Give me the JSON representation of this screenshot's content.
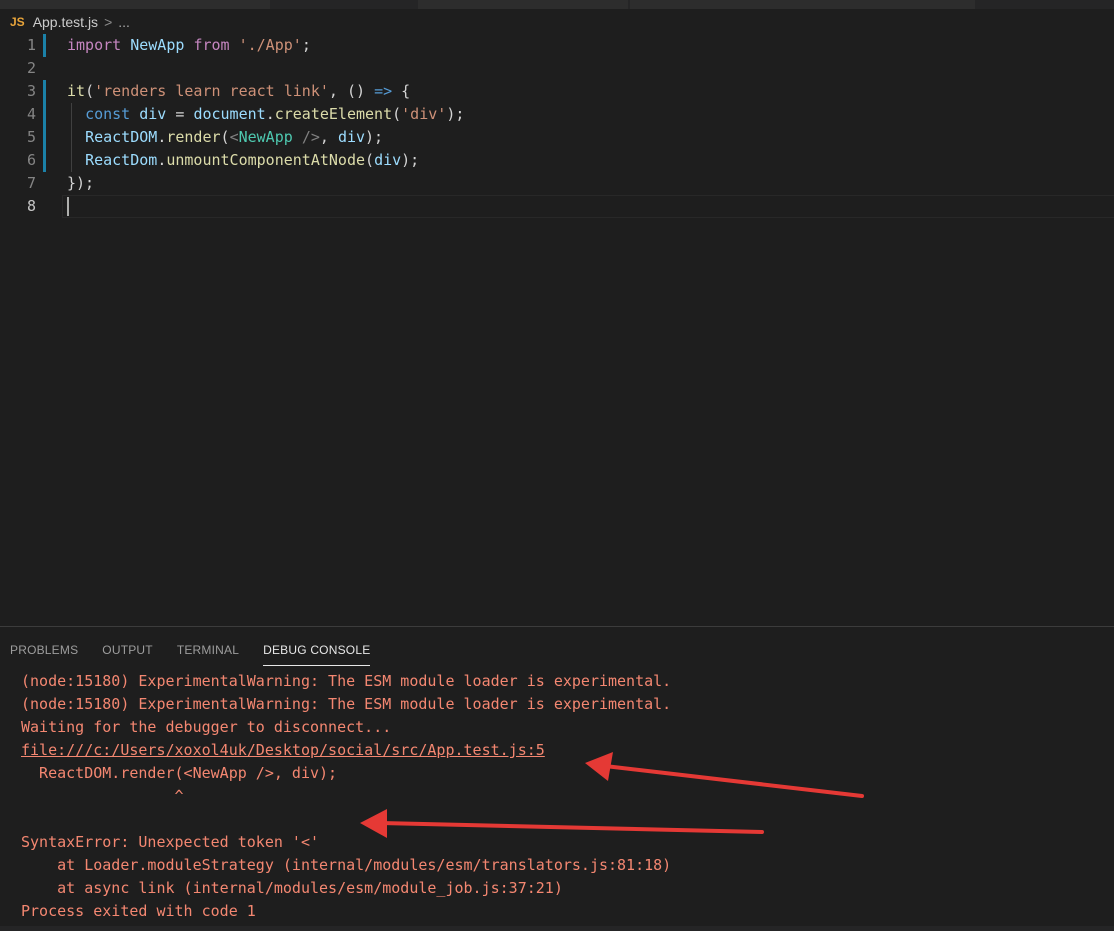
{
  "breadcrumb": {
    "file_type": "JS",
    "file": "App.test.js",
    "separator": ">",
    "more": "..."
  },
  "editor": {
    "line_numbers": [
      "1",
      "2",
      "3",
      "4",
      "5",
      "6",
      "7",
      "8"
    ],
    "lines": [
      [
        {
          "c": "k",
          "t": "import"
        },
        {
          "c": "",
          "t": " "
        },
        {
          "c": "v",
          "t": "NewApp"
        },
        {
          "c": "",
          "t": " "
        },
        {
          "c": "k",
          "t": "from"
        },
        {
          "c": "",
          "t": " "
        },
        {
          "c": "s",
          "t": "'./App'"
        },
        {
          "c": "",
          "t": ";"
        }
      ],
      [],
      [
        {
          "c": "f",
          "t": "it"
        },
        {
          "c": "",
          "t": "("
        },
        {
          "c": "s",
          "t": "'renders learn react link'"
        },
        {
          "c": "",
          "t": ", () "
        },
        {
          "c": "kb",
          "t": "=>"
        },
        {
          "c": "",
          "t": " {"
        }
      ],
      [
        {
          "c": "",
          "t": "  "
        },
        {
          "c": "kb",
          "t": "const"
        },
        {
          "c": "",
          "t": " "
        },
        {
          "c": "v",
          "t": "div"
        },
        {
          "c": "",
          "t": " = "
        },
        {
          "c": "v",
          "t": "document"
        },
        {
          "c": "",
          "t": "."
        },
        {
          "c": "f",
          "t": "createElement"
        },
        {
          "c": "",
          "t": "("
        },
        {
          "c": "s",
          "t": "'div'"
        },
        {
          "c": "",
          "t": ");"
        }
      ],
      [
        {
          "c": "",
          "t": "  "
        },
        {
          "c": "v",
          "t": "ReactDOM"
        },
        {
          "c": "",
          "t": "."
        },
        {
          "c": "f",
          "t": "render"
        },
        {
          "c": "",
          "t": "("
        },
        {
          "c": "p",
          "t": "<"
        },
        {
          "c": "t",
          "t": "NewApp"
        },
        {
          "c": "",
          "t": " "
        },
        {
          "c": "p",
          "t": "/>"
        },
        {
          "c": "",
          "t": ", "
        },
        {
          "c": "v",
          "t": "div"
        },
        {
          "c": "",
          "t": ");"
        }
      ],
      [
        {
          "c": "",
          "t": "  "
        },
        {
          "c": "v",
          "t": "ReactDom"
        },
        {
          "c": "",
          "t": "."
        },
        {
          "c": "f",
          "t": "unmountComponentAtNode"
        },
        {
          "c": "",
          "t": "("
        },
        {
          "c": "v",
          "t": "div"
        },
        {
          "c": "",
          "t": ");"
        }
      ],
      [
        {
          "c": "",
          "t": "});"
        }
      ],
      []
    ]
  },
  "panel": {
    "tabs": [
      "PROBLEMS",
      "OUTPUT",
      "TERMINAL",
      "DEBUG CONSOLE"
    ],
    "active_tab": "DEBUG CONSOLE",
    "console_lines": [
      "(node:15180) ExperimentalWarning: The ESM module loader is experimental.",
      "(node:15180) ExperimentalWarning: The ESM module loader is experimental.",
      "Waiting for the debugger to disconnect...",
      "file:///c:/Users/xoxol4uk/Desktop/social/src/App.test.js:5",
      "  ReactDOM.render(<NewApp />, div);",
      "                 ^",
      "",
      "SyntaxError: Unexpected token '<'",
      "    at Loader.moduleStrategy (internal/modules/esm/translators.js:81:18)",
      "    at async link (internal/modules/esm/module_job.js:37:21)",
      "Process exited with code 1"
    ]
  },
  "colors": {
    "error_text": "#f48771",
    "arrow": "#e53935",
    "background": "#1e1e1e"
  }
}
